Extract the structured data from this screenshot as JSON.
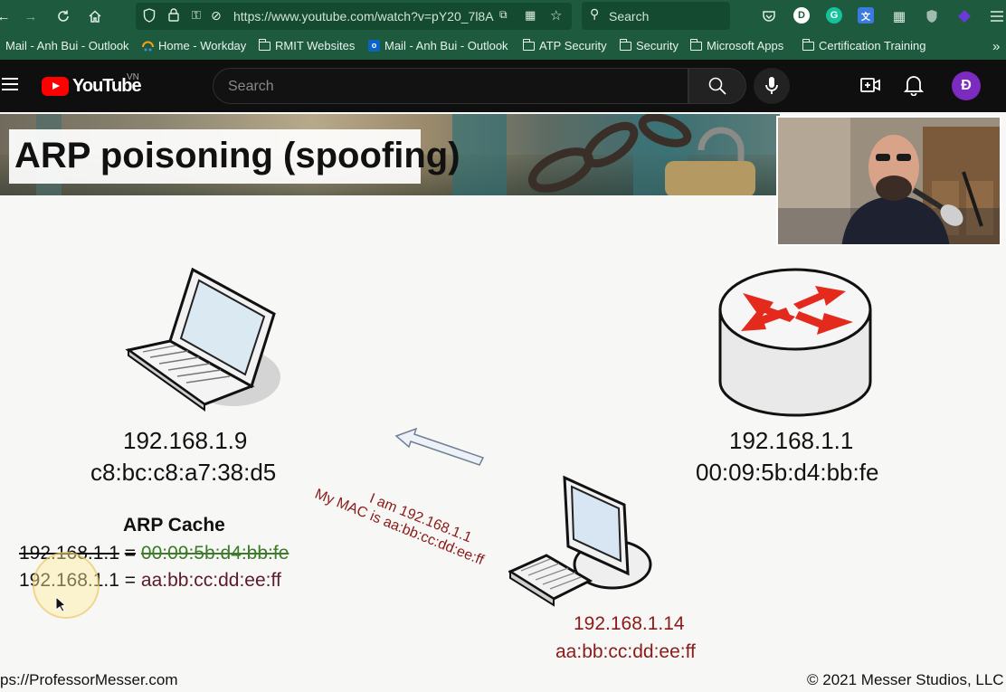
{
  "browser": {
    "url": "https://www.youtube.com/watch?v=pY20_7l8A",
    "search_label": "Search"
  },
  "bookmarks": [
    {
      "label": "Mail - Anh Bui - Outlook",
      "icon": "none"
    },
    {
      "label": "Home - Workday",
      "icon": "workday-icon"
    },
    {
      "label": "RMIT Websites",
      "icon": "folder-icon"
    },
    {
      "label": "Mail - Anh Bui - Outlook",
      "icon": "outlook-icon"
    },
    {
      "label": "ATP Security",
      "icon": "folder-icon"
    },
    {
      "label": "Security",
      "icon": "folder-icon"
    },
    {
      "label": "Microsoft Apps",
      "icon": "folder-icon"
    },
    {
      "label": "Certification Training",
      "icon": "folder-icon"
    }
  ],
  "youtube": {
    "logo_text": "YouTube",
    "country": "VN",
    "search_placeholder": "Search",
    "avatar_letter": "Đ"
  },
  "slide": {
    "title": "ARP poisoning (spoofing)",
    "laptop": {
      "ip": "192.168.1.9",
      "mac": "c8:bc:c8:a7:38:d5"
    },
    "router": {
      "ip": "192.168.1.1",
      "mac": "00:09:5b:d4:bb:fe"
    },
    "attacker": {
      "ip": "192.168.1.14",
      "mac": "aa:bb:cc:dd:ee:ff"
    },
    "message_line1": "I am 192.168.1.1",
    "message_line2": "My MAC is aa:bb:cc:dd:ee:ff",
    "cache_title": "ARP Cache",
    "cache_old_ip": "192.168.1.1",
    "cache_old_mac": "00:09:5b:d4:bb:fe",
    "cache_new_ip": "192.168.1.1",
    "cache_new_mac": "aa:bb:cc:dd:ee:ff",
    "equals": "=",
    "footer_left": "ps://ProfessorMesser.com",
    "footer_right": "© 2021 Messer Studios, LLC"
  },
  "colors": {
    "browser_bar": "#1d5a3e",
    "yt_header": "#0f0f0f",
    "attacker_text": "#8b1a1a",
    "old_mac_green": "#3d7a2a",
    "new_mac_maroon": "#5c1a2a"
  }
}
